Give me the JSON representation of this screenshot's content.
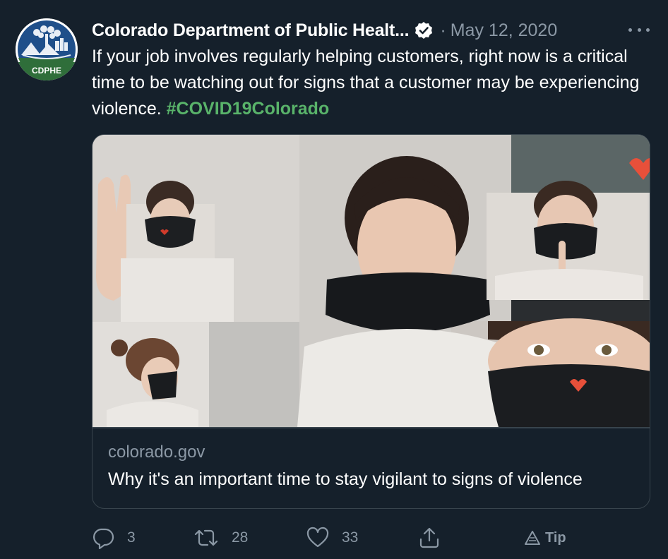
{
  "colors": {
    "background": "#15202b",
    "text_primary": "#ffffff",
    "text_secondary": "#8b98a5",
    "hashtag": "#59b36a",
    "border": "#38444d"
  },
  "tweet": {
    "avatar": {
      "icon": "cdphe-logo",
      "label": "CDPHE"
    },
    "author_name": "Colorado Department of Public Healt...",
    "verified_icon": "verified-badge-icon",
    "separator": "·",
    "date": "May 12, 2020",
    "more_icon": "more-options-icon",
    "text": "If your job involves regularly helping customers, right now is a critical time to be watching out for signs that a customer may be experiencing violence. ",
    "hashtag": "#COVID19Colorado",
    "card": {
      "domain": "colorado.gov",
      "title": "Why it's an important time to stay vigilant to signs of violence"
    },
    "actions": {
      "reply": {
        "icon": "reply-icon",
        "count": "3"
      },
      "retweet": {
        "icon": "retweet-icon",
        "count": "28"
      },
      "like": {
        "icon": "heart-icon",
        "count": "33"
      },
      "share": {
        "icon": "share-icon"
      },
      "tip": {
        "icon": "tip-icon",
        "label": "Tip"
      }
    }
  }
}
